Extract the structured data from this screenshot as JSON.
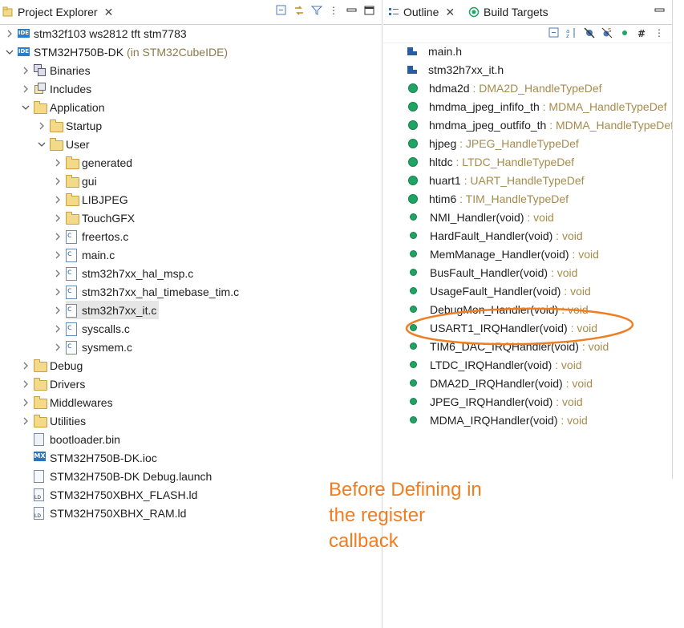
{
  "left_panel": {
    "tab_title": "Project Explorer",
    "tree": [
      {
        "label": "stm32f103 ws2812 tft stm7783",
        "icon": "ide-project-icon",
        "level": 0,
        "arrow": "collapsed"
      },
      {
        "label": "STM32H750B-DK",
        "suffix": "(in STM32CubeIDE)",
        "icon": "ide-project-icon",
        "level": 0,
        "arrow": "expanded"
      },
      {
        "label": "Binaries",
        "icon": "binaries-icon",
        "level": 1,
        "arrow": "collapsed"
      },
      {
        "label": "Includes",
        "icon": "includes-icon",
        "level": 1,
        "arrow": "collapsed"
      },
      {
        "label": "Application",
        "icon": "folder-icon",
        "level": 1,
        "arrow": "expanded"
      },
      {
        "label": "Startup",
        "icon": "folder-icon",
        "level": 2,
        "arrow": "collapsed"
      },
      {
        "label": "User",
        "icon": "folder-icon",
        "level": 2,
        "arrow": "expanded"
      },
      {
        "label": "generated",
        "icon": "folder-icon",
        "level": 3,
        "arrow": "collapsed"
      },
      {
        "label": "gui",
        "icon": "folder-icon",
        "level": 3,
        "arrow": "collapsed"
      },
      {
        "label": "LIBJPEG",
        "icon": "folder-icon",
        "level": 3,
        "arrow": "collapsed"
      },
      {
        "label": "TouchGFX",
        "icon": "folder-icon",
        "level": 3,
        "arrow": "collapsed"
      },
      {
        "label": "freertos.c",
        "icon": "c-file-icon",
        "level": 3,
        "arrow": "collapsed"
      },
      {
        "label": "main.c",
        "icon": "c-file-icon",
        "level": 3,
        "arrow": "collapsed"
      },
      {
        "label": "stm32h7xx_hal_msp.c",
        "icon": "c-file-icon",
        "level": 3,
        "arrow": "collapsed"
      },
      {
        "label": "stm32h7xx_hal_timebase_tim.c",
        "icon": "c-file-icon",
        "level": 3,
        "arrow": "collapsed"
      },
      {
        "label": "stm32h7xx_it.c",
        "icon": "c-file-icon",
        "level": 3,
        "arrow": "collapsed",
        "selected": true
      },
      {
        "label": "syscalls.c",
        "icon": "c-file-icon",
        "level": 3,
        "arrow": "collapsed"
      },
      {
        "label": "sysmem.c",
        "icon": "c-file-icon",
        "level": 3,
        "arrow": "collapsed"
      },
      {
        "label": "Debug",
        "icon": "folder-icon",
        "level": 1,
        "arrow": "collapsed"
      },
      {
        "label": "Drivers",
        "icon": "folder-icon",
        "level": 1,
        "arrow": "collapsed"
      },
      {
        "label": "Middlewares",
        "icon": "folder-icon",
        "level": 1,
        "arrow": "collapsed"
      },
      {
        "label": "Utilities",
        "icon": "folder-icon",
        "level": 1,
        "arrow": "collapsed"
      },
      {
        "label": "bootloader.bin",
        "icon": "bin-file-icon",
        "level": 1,
        "arrow": "none"
      },
      {
        "label": "STM32H750B-DK.ioc",
        "icon": "mx-file-icon",
        "level": 1,
        "arrow": "none"
      },
      {
        "label": "STM32H750B-DK Debug.launch",
        "icon": "launch-file-icon",
        "level": 1,
        "arrow": "none"
      },
      {
        "label": "STM32H750XBHX_FLASH.ld",
        "icon": "ld-file-icon",
        "level": 1,
        "arrow": "none"
      },
      {
        "label": "STM32H750XBHX_RAM.ld",
        "icon": "ld-file-icon",
        "level": 1,
        "arrow": "none"
      }
    ]
  },
  "right_panel": {
    "tab_outline": "Outline",
    "tab_build_targets": "Build Targets",
    "items": [
      {
        "name": "main.h",
        "type": "",
        "icon": "header-include-icon"
      },
      {
        "name": "stm32h7xx_it.h",
        "type": "",
        "icon": "header-include-icon"
      },
      {
        "name": "hdma2d",
        "type": " : DMA2D_HandleTypeDef",
        "icon": "variable-icon"
      },
      {
        "name": "hmdma_jpeg_infifo_th",
        "type": " : MDMA_HandleTypeDef",
        "icon": "variable-icon"
      },
      {
        "name": "hmdma_jpeg_outfifo_th",
        "type": " : MDMA_HandleTypeDef",
        "icon": "variable-icon"
      },
      {
        "name": "hjpeg",
        "type": " : JPEG_HandleTypeDef",
        "icon": "variable-icon"
      },
      {
        "name": "hltdc",
        "type": " : LTDC_HandleTypeDef",
        "icon": "variable-icon"
      },
      {
        "name": "huart1",
        "type": " : UART_HandleTypeDef",
        "icon": "variable-icon"
      },
      {
        "name": "htim6",
        "type": " : TIM_HandleTypeDef",
        "icon": "variable-icon"
      },
      {
        "name": "NMI_Handler(void)",
        "type": " : void",
        "icon": "function-icon"
      },
      {
        "name": "HardFault_Handler(void)",
        "type": " : void",
        "icon": "function-icon"
      },
      {
        "name": "MemManage_Handler(void)",
        "type": " : void",
        "icon": "function-icon"
      },
      {
        "name": "BusFault_Handler(void)",
        "type": " : void",
        "icon": "function-icon"
      },
      {
        "name": "UsageFault_Handler(void)",
        "type": " : void",
        "icon": "function-icon"
      },
      {
        "name": "DebugMon_Handler(void)",
        "type": " : void",
        "icon": "function-icon"
      },
      {
        "name": "USART1_IRQHandler(void)",
        "type": " : void",
        "icon": "function-icon"
      },
      {
        "name": "TIM6_DAC_IRQHandler(void)",
        "type": " : void",
        "icon": "function-icon"
      },
      {
        "name": "LTDC_IRQHandler(void)",
        "type": " : void",
        "icon": "function-icon"
      },
      {
        "name": "DMA2D_IRQHandler(void)",
        "type": " : void",
        "icon": "function-icon"
      },
      {
        "name": "JPEG_IRQHandler(void)",
        "type": " : void",
        "icon": "function-icon"
      },
      {
        "name": "MDMA_IRQHandler(void)",
        "type": " : void",
        "icon": "function-icon"
      }
    ]
  },
  "annotation": {
    "lines": [
      "Before Defining in",
      "the register",
      "callback"
    ],
    "color": "#ef7d22"
  }
}
